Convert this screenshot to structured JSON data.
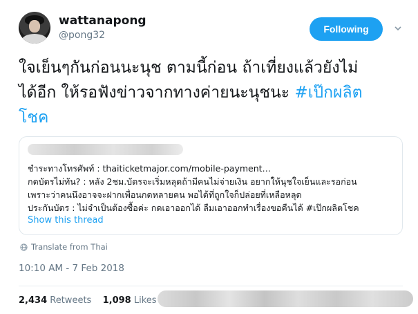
{
  "author": {
    "name": "wattanapong",
    "handle": "@pong32"
  },
  "follow_button": {
    "label": "Following",
    "color": "#1da1f2"
  },
  "tweet": {
    "line1": "ใจเย็นๆกันก่อนนะนุช ตามนี้ก่อน ถ้าเที่ยงแล้วยังไม่",
    "line2_text": "ได้อีก ให้รอฟังข่าวจากทางค่ายนะนุชนะ ",
    "line2_hashtag": "#เป๊กผลิต",
    "line3_hashtag": "โชค"
  },
  "quoted_tweet": {
    "line1": "ชำระทางโทรศัพท์ : thaiticketmajor.com/mobile-payment…",
    "line2": "กดบัตรไม่ทัน? : หลัง 2ชม.บัตรจะเริ่มหลุดถ้ามีคนไม่จ่ายเงิน อยากให้นุชใจเย็นและรอก่อน",
    "line3": "เพราะว่าคนนึงอาจจะฝากเพื่อนกดหลายคน พอได้ที่ถูกใจก็ปล่อยที่เหลือหลุด",
    "line4": "ประกันบัตร : ไม่จำเป็นต้องซื้อค่ะ กดเอาออกได้ ลืมเอาออกทำเรื่องขอคืนได้ #เป๊กผลิตโชค",
    "show_thread": "Show this thread"
  },
  "translate_label": "Translate from Thai",
  "timestamp": "10:10 AM - 7 Feb 2018",
  "stats": {
    "retweets_count": "2,434",
    "retweets_label": "Retweets",
    "likes_count": "1,098",
    "likes_label": "Likes"
  },
  "icons": {
    "caret": "chevron-down-icon",
    "globe": "globe-icon"
  }
}
